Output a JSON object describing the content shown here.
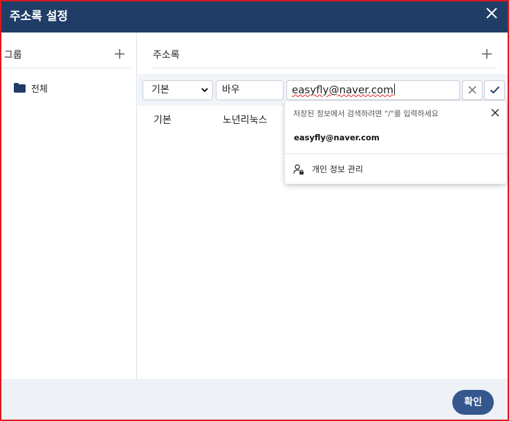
{
  "dialog": {
    "title": "주소록 설정"
  },
  "groups": {
    "header_label": "그룹",
    "items": [
      {
        "label": "전체",
        "icon": "folder-icon"
      }
    ]
  },
  "addressbook": {
    "header_label": "주소록",
    "edit_row": {
      "type_select_value": "기본",
      "name_value": "바우",
      "email_value": "easyfly@naver.com"
    },
    "rows": [
      {
        "type": "기본",
        "name": "노년리눅스"
      }
    ]
  },
  "autocomplete": {
    "hint": "저장된 정보에서 검색하려면 \"/\"를 입력하세요",
    "suggestion": "easyfly@naver.com",
    "manage_label": "개인 정보 관리"
  },
  "footer": {
    "ok_label": "확인"
  },
  "colors": {
    "titlebar": "#1f3d66",
    "frame_border": "#e0161d",
    "ok_button": "#35578d",
    "folder": "#1f3d66",
    "confirm_check": "#1f3d66"
  }
}
